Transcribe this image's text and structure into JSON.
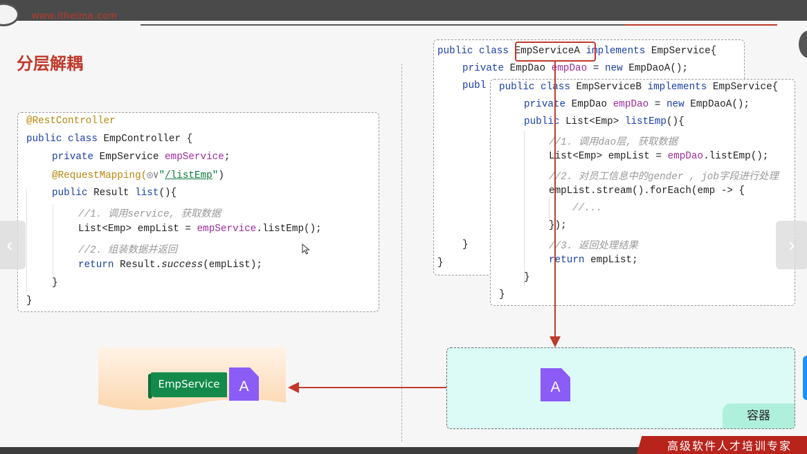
{
  "header": {
    "site_text": "www.itheima.com",
    "slide_title": "分层解耦",
    "footer_text": "高级软件人才培训专家"
  },
  "controller_code": {
    "l1": "@RestController",
    "l2_kw": "public class",
    "l2_rest": " EmpController {",
    "l3_kw": "private",
    "l3_type": " EmpService ",
    "l3_field": "empService",
    "l3_end": ";",
    "l4_ann": "@RequestMapping(",
    "l4_icon": "◎∨",
    "l4_q1": "\"",
    "l4_str": "/listEmp",
    "l4_q2": "\"",
    "l4_end": ")",
    "l5_kw": "public",
    "l5_type": " Result ",
    "l5_method": "list",
    "l5_end": "(){",
    "l6_comment": "//1. 调用service, 获取数据",
    "l7_a": "List<Emp> empList = ",
    "l7_field": "empService",
    "l7_b": ".listEmp();",
    "l8_comment": "//2. 组装数据并返回",
    "l9_kw": "return",
    "l9_a": " Result.",
    "l9_it": "success",
    "l9_b": "(empList);",
    "l10": "}",
    "l11": "}"
  },
  "service_a_code": {
    "l1_kw": "public class",
    "l1_name": "EmpServiceA",
    "l1_kw2": " implements",
    "l1_rest": " EmpService{",
    "l2_kw": "private",
    "l2_type": " EmpDao ",
    "l2_field": "empDao",
    "l2_a": " = ",
    "l2_kw2": "new",
    "l2_b": " EmpDaoA();",
    "l3_kw": "publ",
    "l4": "}",
    "l5": "}"
  },
  "service_b_code": {
    "l1_kw": "public class",
    "l1_name": " EmpServiceB",
    "l1_kw2": " implements",
    "l1_rest": " EmpService{",
    "l2_kw": "private",
    "l2_type": " EmpDao ",
    "l2_field": "empDao",
    "l2_a": " = ",
    "l2_kw2": "new",
    "l2_b": " EmpDaoA();",
    "l3_kw": "public",
    "l3_type": " List<Emp> ",
    "l3_method": "listEmp",
    "l3_end": "(){",
    "l4_comment": "//1. 调用dao层, 获取数据",
    "l5_a": "List<Emp> empList = ",
    "l5_field": "empDao",
    "l5_b": ".listEmp();",
    "l6_comment": "//2. 对员工信息中的gender , job字段进行处理",
    "l7": "empList.stream().forEach(emp -> {",
    "l8_comment": "//...",
    "l9": "});",
    "l10_comment": "//3. 返回处理结果",
    "l11_kw": "return",
    "l11_rest": " empList;",
    "l12": "}",
    "l13": "}"
  },
  "diagram": {
    "empservice_tag": "EmpService",
    "bean_a_left": "A",
    "bean_a_container": "A",
    "container_label": "容器"
  },
  "colors": {
    "accent_red": "#c0392b",
    "tag_green": "#138a4a",
    "bean_purple": "#8b5cf6",
    "container_fill": "#dcfaf6",
    "scroll_fill": "#fde3c8"
  },
  "nav": {
    "prev_icon": "‹",
    "next_icon": "›"
  }
}
